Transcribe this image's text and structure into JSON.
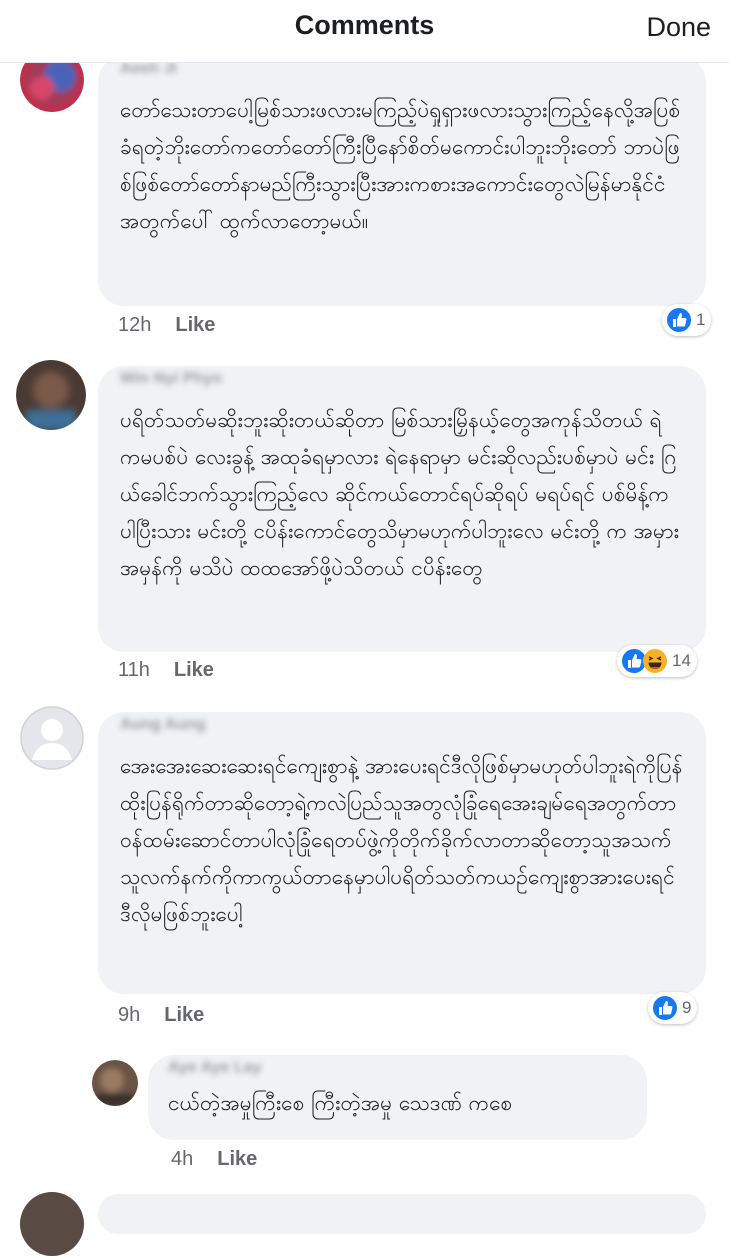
{
  "header": {
    "title": "Comments",
    "done_label": "Done"
  },
  "colors": {
    "bubble": "#f0f2f5",
    "like_blue": "#1877f2",
    "haha_yellow": "#f7b125",
    "meta_gray": "#65676b"
  },
  "comments": [
    {
      "author": "Aeeh Ji",
      "text": "တော်သေးတာပေါ့မြစ်သားဖလားမကြည့်ပဲရှုရှားဖလားသွားကြည့်နေလို့အပြစ်ခံရတဲ့ဘိုးတော်ကတော်တော်ကြီးပြီနော်စိတ်မကောင်းပါဘူးဘိုးတော် ဘာပဲဖြစ်ဖြစ်တော်တော်နာမည်ကြီးသွားပြီးအားကစားအကောင်းတွေလဲမြန်မာနိုင်ငံအတွက်ပေါ် ထွက်လာတော့မယ်။",
      "time": "12h",
      "like_label": "Like",
      "reactions": [
        "like-icon"
      ],
      "reaction_count": "1"
    },
    {
      "author": "Win Nyi Phyo",
      "text": "ပရိတ်သတ်မဆိုးဘူးဆိုးတယ်ဆိုတာ မြစ်သားမြှိနယ့်တွေအကုန်သိတယ် ရဲ ကမပစ်ပဲ လေးခွန့် အထုခံရမှာလား ရဲနေရာမှာ မင်းဆိုလည်းပစ်မှာပဲ မင်း ဂြယ်ခေါင်ဘက်သွားကြည့်လေ ဆိုင်ကယ်တောင်ရပ်ဆိုရပ် မရပ်ရင် ပစ်မိန့်က ပါပြီးသား မင်းတို့ ငပိန်းကောင်တွေသိမှာမဟုက်ပါဘူးလေ မင်းတို့ က အမှားအမှန်ကို မသိပဲ ထထအော်ဖို့ပဲသိတယ် ငပိန်းတွေ",
      "time": "11h",
      "like_label": "Like",
      "reactions": [
        "like-icon",
        "haha-icon"
      ],
      "reaction_count": "14"
    },
    {
      "author": "Aung Aung",
      "text": "အေးအေးဆေးဆေးရင်ကျေးစွာနဲ့ အားပေးရင်ဒီလိုဖြစ်မှာမဟုတ်ပါဘူးရဲကိုပြန်ထိုးပြန်ရိုက်တာဆိုတော့ရဲ့ကလဲပြည်သူအတွလုံခြုံရေအေးချမ်ရေအတွက်တာဝန်ထမ်းဆောင်တာပါလုံခြုံရေတပ်ဖွဲ့ကိုတိုက်ခိုက်လာတာဆိုတော့သူအသက်သူလက်နက်ကိုကာကွယ်တာနေမှာပါပရိတ်သတ်ကယဉ်ကျေးစွာအားပေးရင်ဒီလိုမဖြစ်ဘူးပေါ့",
      "time": "9h",
      "like_label": "Like",
      "reactions": [
        "like-icon"
      ],
      "reaction_count": "9"
    },
    {
      "author": "Aye Aye Lay",
      "text": "ငယ်တဲ့အမှုကြီးစေ ကြီးတဲ့အမှု သေဒဏ် ကစေ",
      "time": "4h",
      "like_label": "Like",
      "reactions": [],
      "reaction_count": ""
    }
  ]
}
